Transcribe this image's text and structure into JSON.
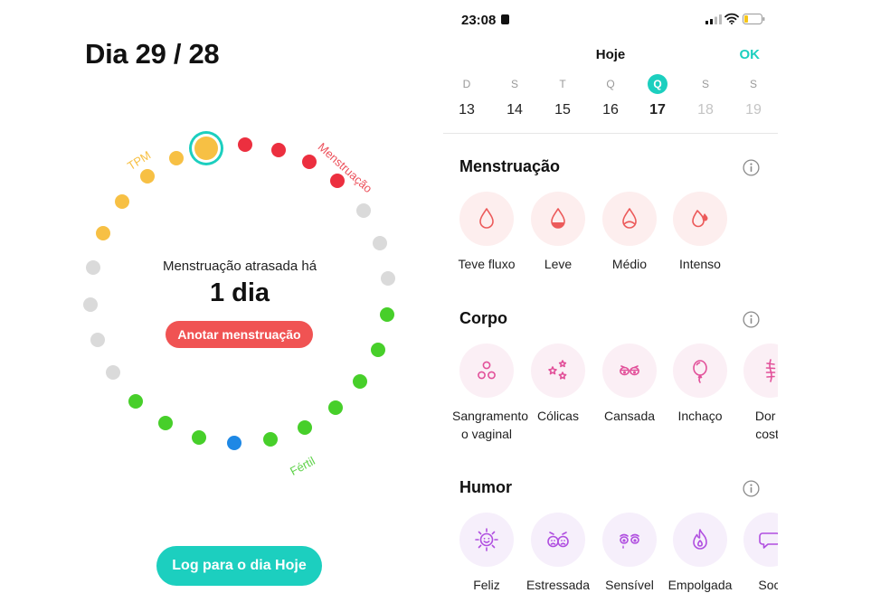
{
  "left": {
    "day_title": "Dia 29 / 28",
    "cycle": {
      "pms_label": "TPM",
      "period_label": "Menstruação",
      "fertile_label": "Fértil",
      "colors": {
        "pms": "#f7c044",
        "period": "#ec2f3f",
        "fertile": "#47cf2a",
        "ovulation": "#1e88e5",
        "neutral": "#dadada",
        "current_ring": "#1ccfbf"
      }
    },
    "late_label": "Menstruação atrasada há",
    "late_value": "1 dia",
    "log_period_button": "Anotar menstruação",
    "log_today_button": "Log para o dia Hoje"
  },
  "phone": {
    "status": {
      "time": "23:08"
    },
    "header_title": "Hoje",
    "ok_label": "OK",
    "week": [
      {
        "weekday": "D",
        "day": "13",
        "state": "past"
      },
      {
        "weekday": "S",
        "day": "14",
        "state": "past"
      },
      {
        "weekday": "T",
        "day": "15",
        "state": "past"
      },
      {
        "weekday": "Q",
        "day": "16",
        "state": "past"
      },
      {
        "weekday": "Q",
        "day": "17",
        "state": "today"
      },
      {
        "weekday": "S",
        "day": "18",
        "state": "future"
      },
      {
        "weekday": "S",
        "day": "19",
        "state": "future"
      }
    ],
    "sections": [
      {
        "title": "Menstruação",
        "color": "#ec5a5a",
        "tint": "red",
        "items": [
          {
            "label": "Teve fluxo",
            "icon": "drop-outline-icon"
          },
          {
            "label": "Leve",
            "icon": "drop-light-icon"
          },
          {
            "label": "Médio",
            "icon": "drop-medium-icon"
          },
          {
            "label": "Intenso",
            "icon": "drop-heavy-icon"
          }
        ]
      },
      {
        "title": "Corpo",
        "color": "#e2519a",
        "tint": "pink",
        "items": [
          {
            "label": "Sangramento\no vaginal",
            "icon": "bubbles-icon"
          },
          {
            "label": "Cólicas",
            "icon": "stars-icon"
          },
          {
            "label": "Cansada",
            "icon": "tired-eyes-icon"
          },
          {
            "label": "Inchaço",
            "icon": "balloon-icon"
          },
          {
            "label": "Dor n\ncosta",
            "icon": "spine-icon"
          }
        ]
      },
      {
        "title": "Humor",
        "color": "#b04fe0",
        "tint": "purple",
        "items": [
          {
            "label": "Feliz",
            "icon": "sun-smile-icon"
          },
          {
            "label": "Estressada",
            "icon": "stressed-faces-icon"
          },
          {
            "label": "Sensível",
            "icon": "teary-eyes-icon"
          },
          {
            "label": "Empolgada",
            "icon": "flame-icon"
          },
          {
            "label": "Soci",
            "icon": "chat-bubble-icon"
          }
        ]
      }
    ]
  }
}
